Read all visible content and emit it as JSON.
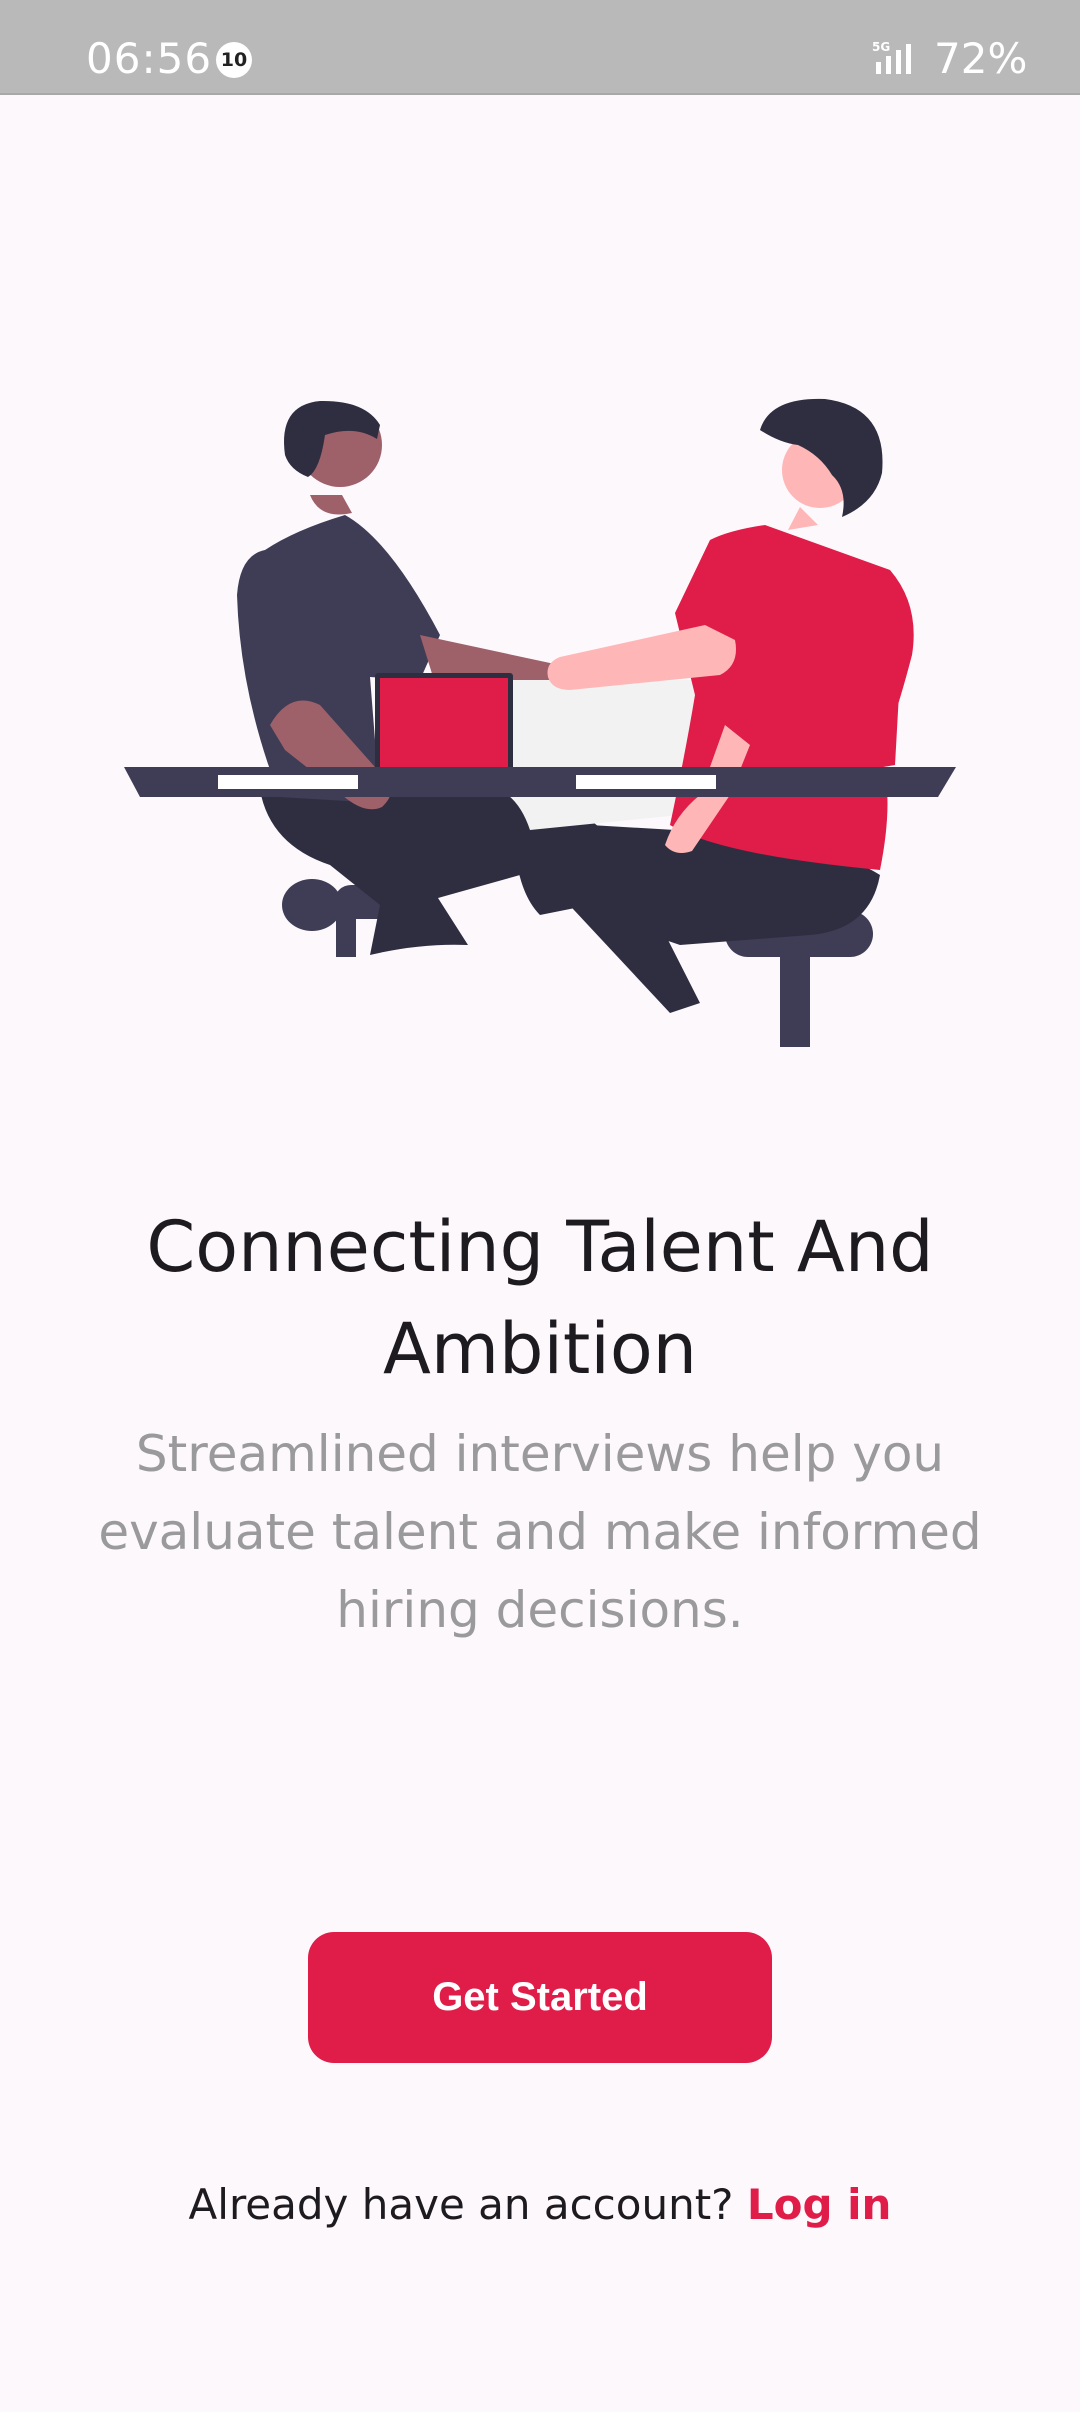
{
  "status_bar": {
    "time": "06:56",
    "notification_count": "10",
    "network": "5G",
    "battery": "72%"
  },
  "illustration": {
    "icon": "handshake-illustration",
    "colors": {
      "accent": "#e01c48",
      "dark": "#3f3d56",
      "darker": "#2f2e41",
      "skin_dark": "#9e616a",
      "skin_light": "#ffb6b6",
      "paper": "#f2f2f2"
    }
  },
  "main": {
    "headline": "Connecting Talent And Ambition",
    "subtitle": "Streamlined interviews help you evaluate talent and make informed hiring decisions.",
    "get_started_label": "Get Started",
    "login_prompt": "Already have an account?",
    "login_link": "Log in"
  },
  "theme": {
    "accent": "#e01c48",
    "background": "#fdf8fc",
    "status_bar": "#bab9ba"
  }
}
